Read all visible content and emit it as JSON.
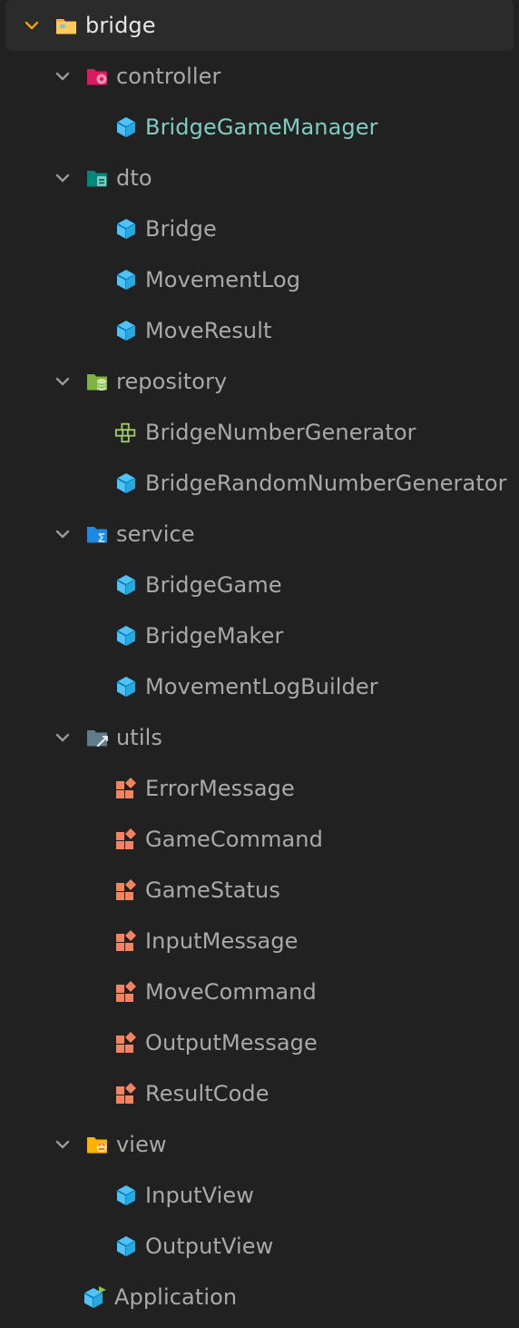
{
  "tree": {
    "root": {
      "label": "bridge",
      "icon": "folder-icon",
      "expanded": true
    },
    "folders": [
      {
        "label": "controller",
        "icon": "folder-controller-icon",
        "items": [
          {
            "label": "BridgeGameManager",
            "icon": "class-icon",
            "selected": true
          }
        ]
      },
      {
        "label": "dto",
        "icon": "folder-dto-icon",
        "items": [
          {
            "label": "Bridge",
            "icon": "class-icon"
          },
          {
            "label": "MovementLog",
            "icon": "class-icon"
          },
          {
            "label": "MoveResult",
            "icon": "class-icon"
          }
        ]
      },
      {
        "label": "repository",
        "icon": "folder-repository-icon",
        "items": [
          {
            "label": "BridgeNumberGenerator",
            "icon": "interface-icon"
          },
          {
            "label": "BridgeRandomNumberGenerator",
            "icon": "class-icon"
          }
        ]
      },
      {
        "label": "service",
        "icon": "folder-service-icon",
        "items": [
          {
            "label": "BridgeGame",
            "icon": "class-icon"
          },
          {
            "label": "BridgeMaker",
            "icon": "class-icon"
          },
          {
            "label": "MovementLogBuilder",
            "icon": "class-icon"
          }
        ]
      },
      {
        "label": "utils",
        "icon": "folder-utils-icon",
        "items": [
          {
            "label": "ErrorMessage",
            "icon": "enum-icon"
          },
          {
            "label": "GameCommand",
            "icon": "enum-icon"
          },
          {
            "label": "GameStatus",
            "icon": "enum-icon"
          },
          {
            "label": "InputMessage",
            "icon": "enum-icon"
          },
          {
            "label": "MoveCommand",
            "icon": "enum-icon"
          },
          {
            "label": "OutputMessage",
            "icon": "enum-icon"
          },
          {
            "label": "ResultCode",
            "icon": "enum-icon"
          }
        ]
      },
      {
        "label": "view",
        "icon": "folder-view-icon",
        "items": [
          {
            "label": "InputView",
            "icon": "class-icon"
          },
          {
            "label": "OutputView",
            "icon": "class-icon"
          }
        ]
      }
    ],
    "files": [
      {
        "label": "Application",
        "icon": "main-class-icon"
      }
    ]
  },
  "colors": {
    "background": "#212121",
    "root_row": "#2b2b2b",
    "text": "#a9a9a9",
    "selected_text": "#80cbc4",
    "chevron_root": "#f0a500",
    "chevron": "#9a9a9a",
    "class_icon": "#4fc3f7",
    "enum_icon": "#f4845f",
    "interface_icon": "#9ccc65"
  }
}
